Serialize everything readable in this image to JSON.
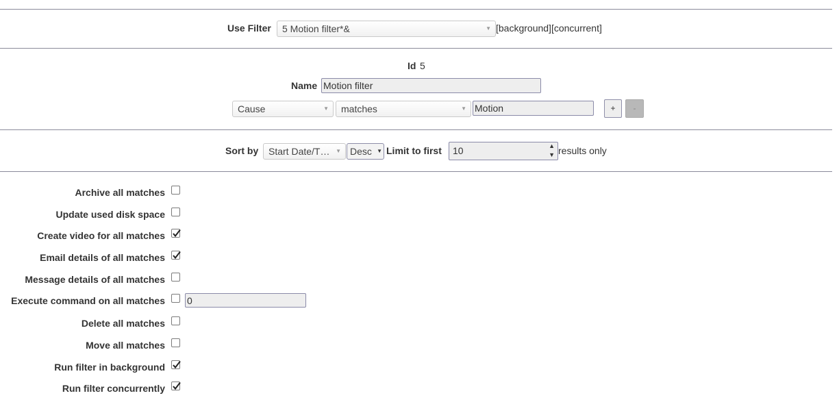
{
  "filter_bar": {
    "label": "Use Filter",
    "selected": "5 Motion filter*&",
    "flags": "[background][concurrent]"
  },
  "filter_details": {
    "id_label": "Id",
    "id_value": "5",
    "name_label": "Name",
    "name_value": "Motion filter",
    "term": {
      "attribute": "Cause",
      "operator": "matches",
      "value": "Motion"
    },
    "add_label": "+",
    "remove_label": "-"
  },
  "sort_bar": {
    "sort_label": "Sort by",
    "sort_field": "Start Date/T…",
    "sort_direction": "Desc",
    "limit_label": "Limit to first",
    "limit_value": "10",
    "results_suffix": "results only"
  },
  "options": [
    {
      "label": "Archive all matches",
      "checked": false
    },
    {
      "label": "Update used disk space",
      "checked": false
    },
    {
      "label": "Create video for all matches",
      "checked": true
    },
    {
      "label": "Email details of all matches",
      "checked": true
    },
    {
      "label": "Message details of all matches",
      "checked": false
    },
    {
      "label": "Execute command on all matches",
      "checked": false
    },
    {
      "label": "Delete all matches",
      "checked": false
    },
    {
      "label": "Move all matches",
      "checked": false
    },
    {
      "label": "Run filter in background",
      "checked": true
    },
    {
      "label": "Run filter concurrently",
      "checked": true
    }
  ],
  "execute_command_value": "0"
}
